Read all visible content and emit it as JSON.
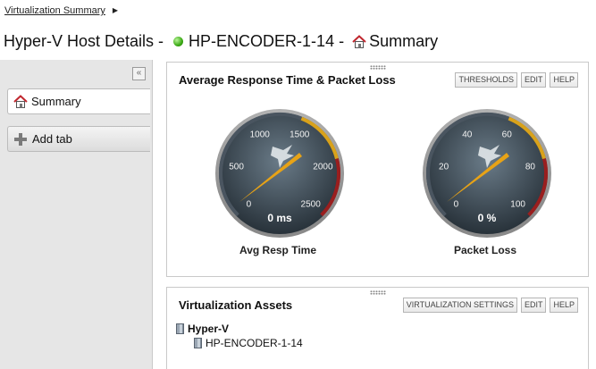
{
  "breadcrumb": {
    "link": "Virtualization Summary"
  },
  "page": {
    "title_prefix": "Hyper-V Host Details - ",
    "host": "HP-ENCODER-1-14",
    "separator": " - ",
    "view": "Summary",
    "status_color": "#3aa814"
  },
  "sidebar": {
    "collapse_label": "«",
    "tabs": [
      {
        "label": "Summary",
        "icon": "house-icon",
        "active": true
      }
    ],
    "add_tab_label": "Add tab"
  },
  "panel_perf": {
    "title": "Average Response Time & Packet Loss",
    "buttons": {
      "thresholds": "THRESHOLDS",
      "edit": "EDIT",
      "help": "HELP"
    },
    "gauges": [
      {
        "label": "Avg Resp Time",
        "value": 0,
        "reading": "0 ms",
        "min": 0,
        "max": 2500,
        "ticks": [
          "0",
          "500",
          "1000",
          "1500",
          "2000",
          "2500"
        ]
      },
      {
        "label": "Packet Loss",
        "value": 0,
        "reading": "0 %",
        "min": 0,
        "max": 100,
        "ticks": [
          "0",
          "20",
          "40",
          "60",
          "80",
          "100"
        ]
      }
    ]
  },
  "panel_assets": {
    "title": "Virtualization Assets",
    "buttons": {
      "settings": "VIRTUALIZATION SETTINGS",
      "edit": "EDIT",
      "help": "HELP"
    },
    "tree": {
      "root": "Hyper-V",
      "child": "HP-ENCODER-1-14"
    }
  },
  "colors": {
    "needle": "#e8a316",
    "warn_arc": "#d9a21a",
    "crit_arc": "#9a1e1e"
  }
}
